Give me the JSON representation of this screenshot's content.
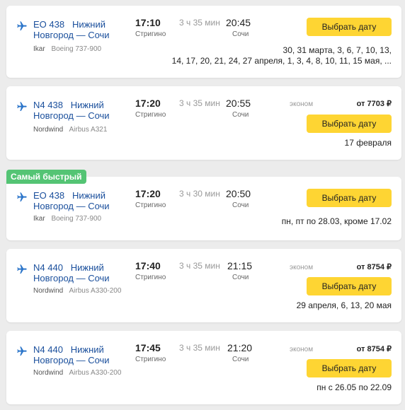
{
  "fastest_badge": "Самый быстрый",
  "select_button_label": "Выбрать дату",
  "flights": [
    {
      "number": "EO 438",
      "route": "Нижний Новгород — Сочи",
      "airline": "Ikar",
      "aircraft": "Boeing 737-900",
      "departure_time": "17:10",
      "departure_airport": "Стригино",
      "duration": "3 ч 35 мин",
      "arrival_time": "20:45",
      "arrival_airport": "Сочи",
      "class": "",
      "price": "",
      "dates_line1": "30, 31 марта, 3, 6, 7, 10, 13,",
      "dates_line2": "14, 17, 20, 21, 24, 27 апреля, 1, 3, 4, 8, 10, 11, 15 мая, ..."
    },
    {
      "number": "N4 438",
      "route": "Нижний Новгород — Сочи",
      "airline": "Nordwind",
      "aircraft": "Airbus A321",
      "departure_time": "17:20",
      "departure_airport": "Стригино",
      "duration": "3 ч 35 мин",
      "arrival_time": "20:55",
      "arrival_airport": "Сочи",
      "class": "эконом",
      "price": "от 7703 ₽",
      "dates_line1": "17 февраля",
      "dates_line2": ""
    },
    {
      "number": "EO 438",
      "route": "Нижний Новгород — Сочи",
      "airline": "Ikar",
      "aircraft": "Boeing 737-900",
      "departure_time": "17:20",
      "departure_airport": "Стригино",
      "duration": "3 ч 30 мин",
      "arrival_time": "20:50",
      "arrival_airport": "Сочи",
      "class": "",
      "price": "",
      "dates_line1": "пн, пт по 28.03, кроме 17.02",
      "dates_line2": ""
    },
    {
      "number": "N4 440",
      "route": "Нижний Новгород — Сочи",
      "airline": "Nordwind",
      "aircraft": "Airbus A330-200",
      "departure_time": "17:40",
      "departure_airport": "Стригино",
      "duration": "3 ч 35 мин",
      "arrival_time": "21:15",
      "arrival_airport": "Сочи",
      "class": "эконом",
      "price": "от 8754 ₽",
      "dates_line1": "29 апреля, 6, 13, 20 мая",
      "dates_line2": ""
    },
    {
      "number": "N4 440",
      "route": "Нижний Новгород — Сочи",
      "airline": "Nordwind",
      "aircraft": "Airbus A330-200",
      "departure_time": "17:45",
      "departure_airport": "Стригино",
      "duration": "3 ч 35 мин",
      "arrival_time": "21:20",
      "arrival_airport": "Сочи",
      "class": "эконом",
      "price": "от 8754 ₽",
      "dates_line1": "пн с 26.05 по 22.09",
      "dates_line2": ""
    }
  ],
  "colors": {
    "background": "#ececec",
    "button": "#fed533",
    "link": "#1a4f9c",
    "badge": "#54c474"
  },
  "icons": {
    "plane": "plane-icon"
  }
}
